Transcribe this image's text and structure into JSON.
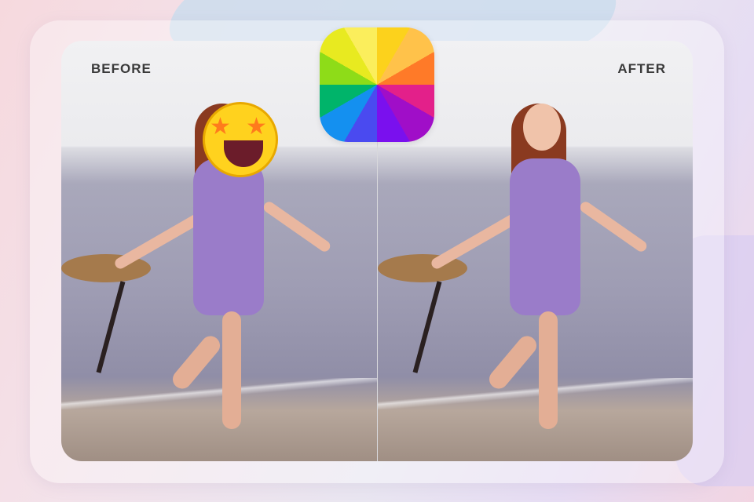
{
  "labels": {
    "before": "BEFORE",
    "after": "AFTER"
  },
  "logo": {
    "icon": "color-wheel-app-icon",
    "colors": [
      "#fcd21c",
      "#ffc24a",
      "#ff7a28",
      "#e3208a",
      "#a00ec8",
      "#7a10ee",
      "#4a4af0",
      "#1490f0",
      "#00b46a",
      "#8edc18",
      "#e8ea20",
      "#fbee5c"
    ]
  },
  "overlay": {
    "icon": "star-struck-emoji"
  }
}
